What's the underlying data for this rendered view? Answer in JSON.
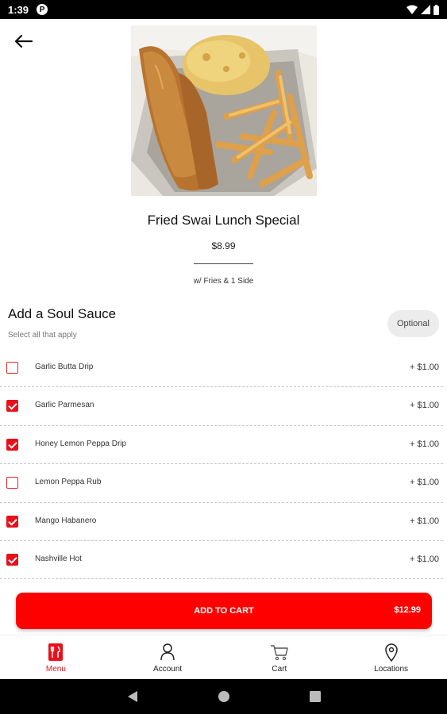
{
  "status_bar": {
    "time": "1:39",
    "app_badge": "P"
  },
  "item": {
    "title": "Fried Swai Lunch Special",
    "price": "$8.99",
    "description": "w/ Fries & 1 Side"
  },
  "section": {
    "title": "Add a Soul Sauce",
    "subtitle": "Select all that apply",
    "badge": "Optional"
  },
  "options": [
    {
      "name": "Garlic Butta Drip",
      "price": "+ $1.00",
      "checked": false
    },
    {
      "name": "Garlic Parmesan",
      "price": "+ $1.00",
      "checked": true
    },
    {
      "name": "Honey Lemon Peppa Drip",
      "price": "+ $1.00",
      "checked": true
    },
    {
      "name": "Lemon Peppa Rub",
      "price": "+ $1.00",
      "checked": false
    },
    {
      "name": "Mango Habanero",
      "price": "+ $1.00",
      "checked": true
    },
    {
      "name": "Nashville Hot",
      "price": "+ $1.00",
      "checked": true
    }
  ],
  "cart_button": {
    "label": "ADD TO CART",
    "total": "$12.99"
  },
  "bottom_nav": [
    {
      "label": "Menu",
      "icon": "menu-fork-knife-icon",
      "active": true
    },
    {
      "label": "Account",
      "icon": "person-icon",
      "active": false
    },
    {
      "label": "Cart",
      "icon": "cart-icon",
      "active": false
    },
    {
      "label": "Locations",
      "icon": "location-pin-icon",
      "active": false
    }
  ],
  "colors": {
    "accent": "#ff0000",
    "checkbox": "#e8101a",
    "pill_bg": "#ececec"
  }
}
